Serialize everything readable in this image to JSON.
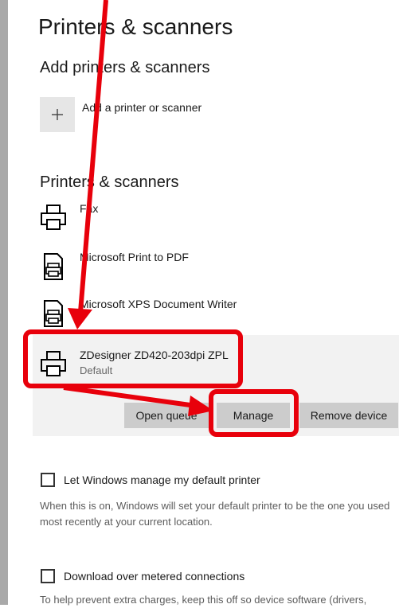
{
  "page": {
    "title": "Printers & scanners"
  },
  "add_section": {
    "heading": "Add printers & scanners",
    "add_label": "Add a printer or scanner",
    "add_icon": "plus-icon"
  },
  "printers_section": {
    "heading": "Printers & scanners",
    "printers": [
      {
        "name": "Fax",
        "status": "",
        "icon": "printer-icon"
      },
      {
        "name": "Microsoft Print to PDF",
        "status": "",
        "icon": "document-printer-icon"
      },
      {
        "name": "Microsoft XPS Document Writer",
        "status": "",
        "icon": "document-printer-icon"
      },
      {
        "name": "ZDesigner ZD420-203dpi ZPL",
        "status": "Default",
        "icon": "printer-icon",
        "selected": true
      }
    ],
    "actions": {
      "open_queue": "Open queue",
      "manage": "Manage",
      "remove_device": "Remove device"
    }
  },
  "options": {
    "manage_default": {
      "label": "Let Windows manage my default printer",
      "checked": false,
      "description": "When this is on, Windows will set your default printer to be the one you used most recently at your current location."
    },
    "metered": {
      "label": "Download over metered connections",
      "checked": false,
      "description": "To help prevent extra charges, keep this off so device software (drivers,"
    }
  },
  "annotation": {
    "color": "#e8000b"
  },
  "colors": {
    "panel": "#f2f2f2",
    "button": "#cccccc",
    "left_strip": "#a9a9a9"
  }
}
